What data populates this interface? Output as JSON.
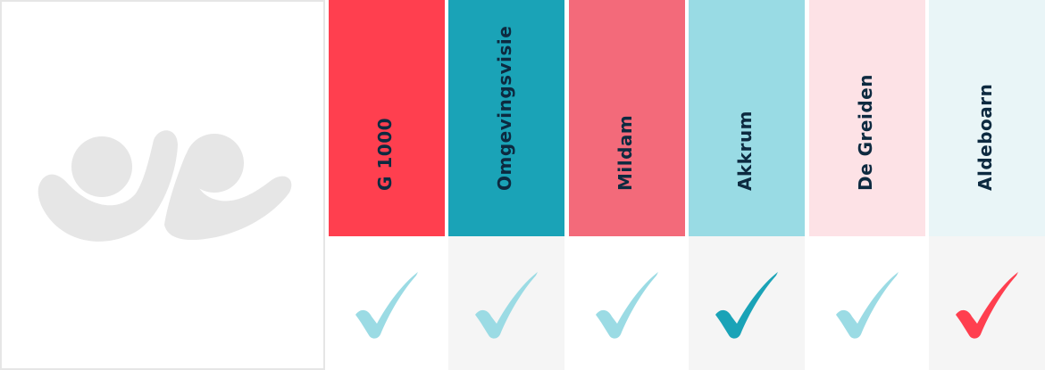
{
  "logo": {
    "icon": "two-figures-logo-icon",
    "color": "#e6e6e6"
  },
  "columns": [
    {
      "label": "G 1000",
      "header_color": "#ff3f4f",
      "body_color": "#ffffff",
      "check_color": "#9bdbe4",
      "icon": "checkmark-icon"
    },
    {
      "label": "Omgevingsvisie",
      "header_color": "#1aa3b7",
      "body_color": "#f5f5f5",
      "check_color": "#9bdbe4",
      "icon": "checkmark-icon"
    },
    {
      "label": "Mildam",
      "header_color": "#f36a7a",
      "body_color": "#ffffff",
      "check_color": "#9bdbe4",
      "icon": "checkmark-icon"
    },
    {
      "label": "Akkrum",
      "header_color": "#99dbe4",
      "body_color": "#f5f5f5",
      "check_color": "#1aa3b7",
      "icon": "checkmark-icon"
    },
    {
      "label": "De Greiden",
      "header_color": "#fde2e6",
      "body_color": "#ffffff",
      "check_color": "#9bdbe4",
      "icon": "checkmark-icon"
    },
    {
      "label": "Aldeboarn",
      "header_color": "#e9f5f7",
      "body_color": "#f5f5f5",
      "check_color": "#ff3f4f",
      "icon": "checkmark-icon"
    }
  ]
}
